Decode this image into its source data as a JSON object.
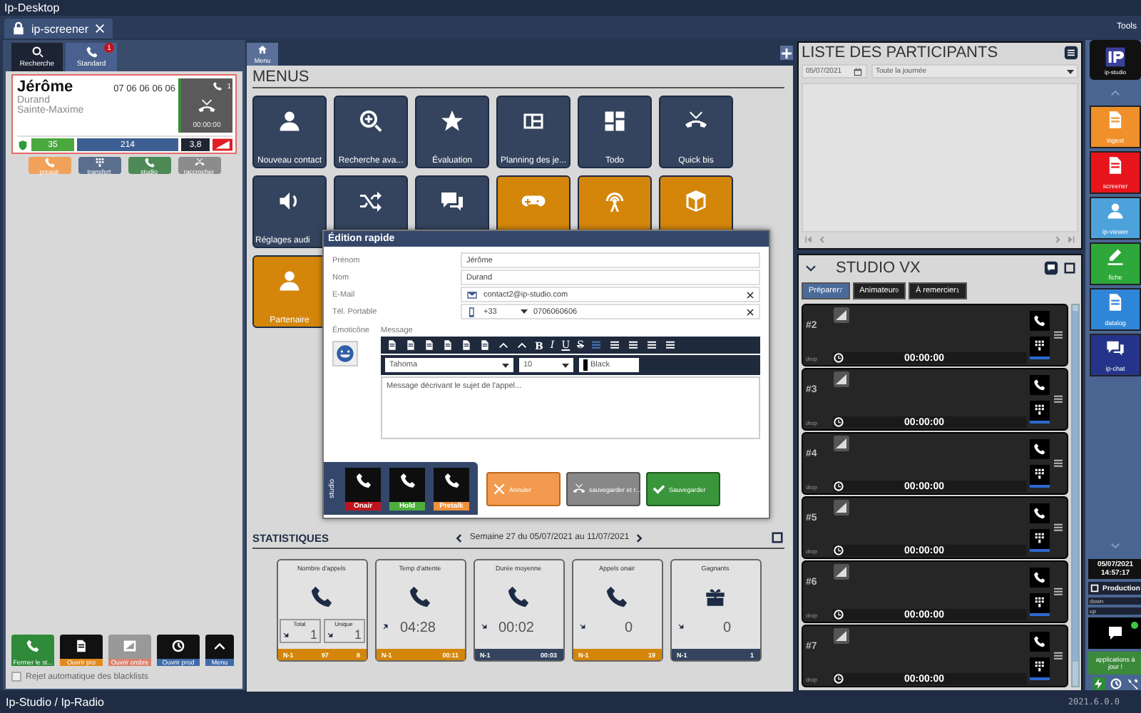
{
  "window": {
    "title": "Ip-Desktop",
    "tools": "Tools"
  },
  "doc_tab": {
    "label": "ip-screener"
  },
  "left_tabs": [
    {
      "label": "Recherche",
      "selected": false
    },
    {
      "label": "Standard",
      "selected": true,
      "badge": "1"
    }
  ],
  "caller": {
    "first_name": "Jérôme",
    "phone": "07 06 06 06 06",
    "last_name": "Durand",
    "city": "Sainte-Maxime",
    "line_count": "1",
    "timer": "00:00:00",
    "calls": "35",
    "contacts": "214",
    "rating": "3,8"
  },
  "call_actions": [
    {
      "label": "preask",
      "color": "#f0a25a"
    },
    {
      "label": "transfert",
      "color": "#5a6e8e"
    },
    {
      "label": "studio",
      "color": "#4d8a57"
    },
    {
      "label": "raccrocher",
      "color": "#8c8c8c"
    }
  ],
  "left_buttons": [
    {
      "label": "Fermer le st...",
      "color": "#2f8a3a"
    },
    {
      "label": "Ouvrir pro",
      "color": "#e08a1e"
    },
    {
      "label": "Ouvrir ombre",
      "color": "#d9826e"
    },
    {
      "label": "Ouvrir prod",
      "color": "#3f6aa8"
    },
    {
      "label": "Menu",
      "color": "#3f6aa8"
    }
  ],
  "blacklist": {
    "label": "Rejet automatique des blacklists",
    "checked": false
  },
  "center_tab": {
    "label": "Menu",
    "selected": true
  },
  "menus": {
    "title": "MENUS",
    "rows": [
      [
        {
          "label": "Nouveau contact",
          "color": "#34445e"
        },
        {
          "label": "Recherche ava...",
          "color": "#34445e"
        },
        {
          "label": "Évaluation",
          "color": "#34445e"
        },
        {
          "label": "Planning des je...",
          "color": "#34445e"
        },
        {
          "label": "Todo",
          "color": "#34445e"
        },
        {
          "label": "Quick bis",
          "color": "#34445e"
        }
      ],
      [
        {
          "label": "Réglages audi",
          "color": "#34445e"
        },
        {
          "color": "#34445e"
        },
        {
          "color": "#34445e"
        },
        {
          "color": "#d4860b"
        },
        {
          "color": "#d4860b"
        },
        {
          "color": "#d4860b"
        }
      ],
      [
        {
          "label": "Partenaire",
          "color": "#d4860b"
        }
      ]
    ]
  },
  "dialog": {
    "title": "Édition rapide",
    "fields": [
      {
        "label": "Prénom",
        "value": "Jérôme",
        "kind": "text"
      },
      {
        "label": "Nom",
        "value": "Durand",
        "kind": "text"
      },
      {
        "label": "E-Mail",
        "value": "contact2@ip-studio.com",
        "kind": "email"
      },
      {
        "label": "Tél. Portable",
        "prefix": "+33",
        "value": "0706060606",
        "kind": "phone"
      }
    ],
    "emoticon_label": "Émoticône",
    "message_label": "Message",
    "format_buttons": [
      "B",
      "I",
      "U",
      "S"
    ],
    "font": "Tahoma",
    "size": "10",
    "text_color": "Black",
    "message_placeholder": "Message décrivant le sujet de l'appel...",
    "studio_label": "studio",
    "studio_buttons": [
      {
        "label": "Onair",
        "color": "#c0141c"
      },
      {
        "label": "Hold",
        "color": "#4caf3c"
      },
      {
        "label": "Pretalk",
        "color": "#f0903a"
      }
    ],
    "buttons": [
      {
        "label": "Annuler",
        "kind": "cancel"
      },
      {
        "label": "sauvegarder et r...",
        "kind": "hangup"
      },
      {
        "label": "Sauvegarder",
        "kind": "save"
      }
    ]
  },
  "stats": {
    "title": "STATISTIQUES",
    "week": "Semaine 27 du 05/07/2021 au 11/07/2021",
    "cards": [
      {
        "title": "Nombre d'appels",
        "kind": "split",
        "parts": [
          {
            "label": "Total",
            "value": "1",
            "rising": false
          },
          {
            "label": "Unique",
            "value": "1",
            "rising": false
          }
        ],
        "footer": [
          "N-1",
          "97",
          "8"
        ],
        "color": "#d4860b"
      },
      {
        "title": "Temp d'attente",
        "kind": "single",
        "value": "04:28",
        "rising": true,
        "footer": [
          "N-1",
          "00:11"
        ],
        "color": "#d4860b"
      },
      {
        "title": "Durée moyenne",
        "kind": "single",
        "value": "00:02",
        "rising": false,
        "footer": [
          "N-1",
          "00:03"
        ],
        "color": "#34445e"
      },
      {
        "title": "Appels onair",
        "kind": "single",
        "value": "0",
        "rising": false,
        "footer": [
          "N-1",
          "19"
        ],
        "color": "#d4860b"
      },
      {
        "title": "Gagnants",
        "kind": "single",
        "value": "0",
        "rising": false,
        "footer": [
          "N-1",
          "1"
        ],
        "color": "#34445e"
      }
    ]
  },
  "participants": {
    "title": "LISTE DES PARTICIPANTS",
    "date": "05/07/2021",
    "period": "Toute la journée"
  },
  "studio": {
    "title": "STUDIO VX",
    "tabs": [
      {
        "label": "Préparer",
        "count": "7",
        "selected": true
      },
      {
        "label": "Animateur",
        "count": "0",
        "selected": false
      },
      {
        "label": "À remercier",
        "count": "1",
        "selected": false
      }
    ],
    "slots": [
      {
        "number": "#2",
        "drop": "drop",
        "time": "00:00:00"
      },
      {
        "number": "#3",
        "drop": "drop",
        "time": "00:00:00"
      },
      {
        "number": "#4",
        "drop": "drop",
        "time": "00:00:00"
      },
      {
        "number": "#5",
        "drop": "drop",
        "time": "00:00:00"
      },
      {
        "number": "#6",
        "drop": "drop",
        "time": "00:00:00"
      },
      {
        "number": "#7",
        "drop": "drop",
        "time": "00:00:00"
      }
    ]
  },
  "sidebar": {
    "logo_caption": "ip-studio",
    "apps": [
      {
        "label": "ingest",
        "color": "#f0902a"
      },
      {
        "label": "screener",
        "color": "#e8141c"
      },
      {
        "label": "ip-viewer",
        "color": "#4ea2dc"
      },
      {
        "label": "fiche",
        "color": "#2ea83a"
      },
      {
        "label": "datalog",
        "color": "#2f86d8"
      },
      {
        "label": "ip-chat",
        "color": "#25348a"
      }
    ],
    "date": "05/07/2021",
    "time": "14:57:17",
    "production": "Production",
    "down": "down",
    "up": "up",
    "online": true,
    "updates": "applications à jour !"
  },
  "status_bar": {
    "left": "Ip-Studio / Ip-Radio",
    "version": "2021.6.0.0"
  }
}
